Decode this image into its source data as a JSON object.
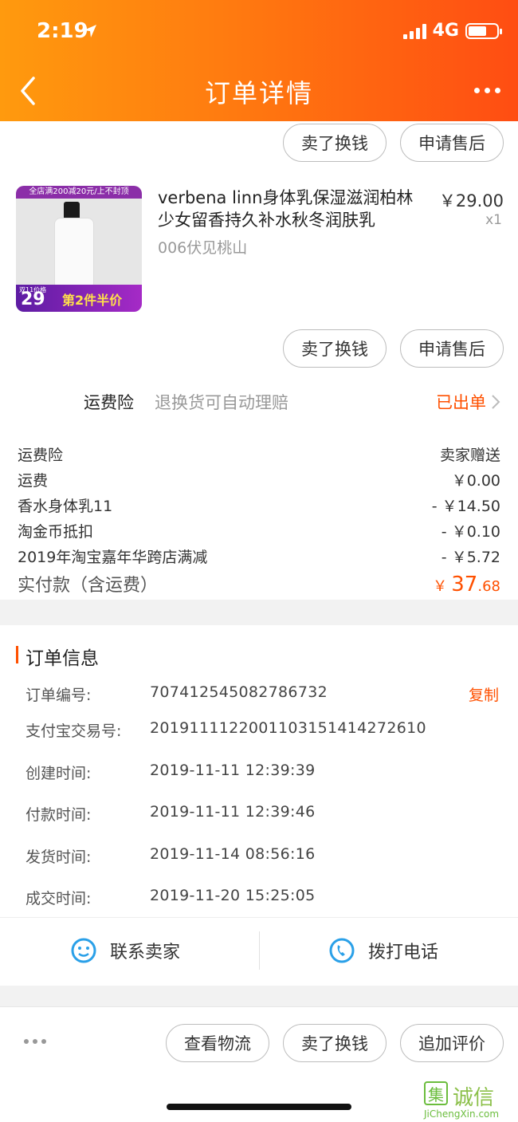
{
  "status_bar": {
    "time": "2:19",
    "network": "4G"
  },
  "nav": {
    "title": "订单详情"
  },
  "top_actions": {
    "sell_label": "卖了换钱",
    "after_sale_label": "申请售后"
  },
  "product": {
    "name": "verbena linn身体乳保湿滋润柏林少女留香持久补水秋冬润肤乳",
    "sku": "006伏见桃山",
    "price": "￥29.00",
    "quantity": "x1",
    "image_ribbon": "全店满200减20元/上不封顶",
    "image_promo_small": "双11价格",
    "image_promo_price": "29",
    "image_promo_text": "第2件半价",
    "sell_label": "卖了换钱",
    "after_sale_label": "申请售后"
  },
  "insurance": {
    "title": "运费险",
    "desc": "退换货可自动理赔",
    "status": "已出单"
  },
  "fees": [
    {
      "label": "运费险",
      "value": "卖家赠送"
    },
    {
      "label": "运费",
      "value": "￥0.00"
    },
    {
      "label": "香水身体乳11",
      "value": "- ￥14.50"
    },
    {
      "label": "淘金币抵扣",
      "value": "- ￥0.10"
    },
    {
      "label": "2019年淘宝嘉年华跨店满减",
      "value": "- ￥5.72"
    }
  ],
  "total": {
    "label": "实付款（含运费）",
    "currency": "￥",
    "integer": "37",
    "decimal": ".68"
  },
  "order_info": {
    "title": "订单信息",
    "copy_label": "复制",
    "rows": [
      {
        "label": "订单编号:",
        "value": "707412545082786732"
      },
      {
        "label": "支付宝交易号:",
        "value": "2019111122001103151414272610"
      },
      {
        "label": "创建时间:",
        "value": "2019-11-11 12:39:39"
      },
      {
        "label": "付款时间:",
        "value": "2019-11-11 12:39:46"
      },
      {
        "label": "发货时间:",
        "value": "2019-11-14 08:56:16"
      },
      {
        "label": "成交时间:",
        "value": "2019-11-20 15:25:05"
      }
    ]
  },
  "contact": {
    "seller_label": "联系卖家",
    "phone_label": "拨打电话"
  },
  "bottom_actions": {
    "logistics_label": "查看物流",
    "sell_label": "卖了换钱",
    "review_label": "追加评价"
  },
  "watermark": {
    "mark": "集",
    "word": "诚信",
    "url": "JiChengXin.com"
  },
  "colors": {
    "accent": "#ff5000",
    "header_start": "#ff9a0e",
    "header_end": "#ff4d12"
  }
}
